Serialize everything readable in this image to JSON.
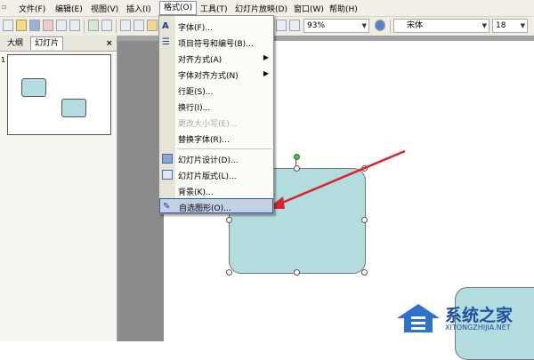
{
  "menubar": {
    "items": [
      {
        "label": "文件(F)"
      },
      {
        "label": "编辑(E)"
      },
      {
        "label": "视图(V)"
      },
      {
        "label": "插入(I)"
      },
      {
        "label": "格式(O)"
      },
      {
        "label": "工具(T)"
      },
      {
        "label": "幻灯片放映(D)"
      },
      {
        "label": "窗口(W)"
      },
      {
        "label": "帮助(H)"
      }
    ]
  },
  "toolbar": {
    "zoom": "93%",
    "font": "宋体",
    "font_size": "18"
  },
  "left_panel": {
    "tabs": [
      {
        "label": "大纲"
      },
      {
        "label": "幻灯片"
      }
    ],
    "close": "×",
    "slide_number": "1"
  },
  "format_menu": {
    "items": [
      {
        "label": "字体(F)...",
        "icon": "font-icon"
      },
      {
        "label": "项目符号和编号(B)...",
        "icon": "bullets-icon"
      },
      {
        "label": "对齐方式(A)",
        "submenu": true
      },
      {
        "label": "字体对齐方式(N)",
        "submenu": true
      },
      {
        "label": "行距(S)..."
      },
      {
        "label": "换行(I)..."
      },
      {
        "label": "更改大小写(E)...",
        "disabled": true
      },
      {
        "label": "替换字体(R)..."
      },
      {
        "label": "幻灯片设计(D)...",
        "icon": "slide-design-icon"
      },
      {
        "label": "幻灯片版式(L)...",
        "icon": "slide-layout-icon"
      },
      {
        "label": "背景(K)..."
      },
      {
        "label": "自选图形(O)...",
        "icon": "autoshape-icon",
        "highlighted": true
      }
    ]
  },
  "watermark": {
    "text": "系统之家",
    "subtext": "XITONGZHIJIA.NET"
  },
  "colors": {
    "shape_fill": "#b2dcde",
    "highlight": "#c3d0e6",
    "arrow": "#d9232d"
  }
}
